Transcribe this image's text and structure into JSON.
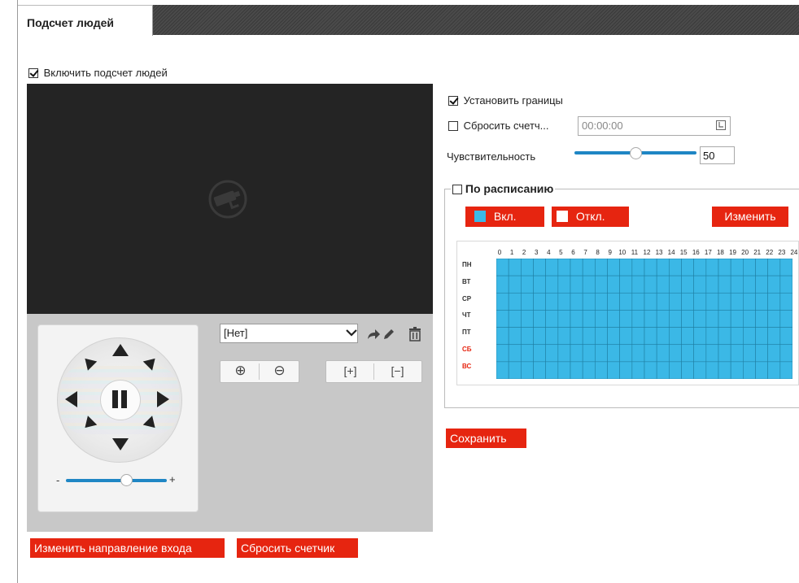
{
  "tab": {
    "title": "Подсчет людей"
  },
  "enable_counting": {
    "label": "Включить подсчет людей",
    "checked": true
  },
  "ptz": {
    "preset_value": "[Нет]",
    "icons": [
      "call-preset-icon",
      "edit-preset-icon",
      "delete-preset-icon"
    ],
    "zoom_in_glyph": "⊕",
    "zoom_out_glyph": "⊖",
    "focus_near_glyph": "[+]",
    "focus_far_glyph": "[−]",
    "speed_minus": "-",
    "speed_plus": "+"
  },
  "settings": {
    "set_borders": {
      "label": "Установить границы",
      "checked": true
    },
    "reset_counter_time": {
      "label": "Сбросить счетч...",
      "checked": false,
      "value": "00:00:00"
    },
    "sensitivity": {
      "label": "Чувствительность",
      "value": "50",
      "level": 0.5
    }
  },
  "schedule": {
    "legend": "По расписанию",
    "checked": false,
    "on_label": "Вкл.",
    "off_label": "Откл.",
    "edit_label": "Изменить",
    "on_color": "#3bb8e6",
    "hours": [
      "0",
      "1",
      "2",
      "3",
      "4",
      "5",
      "6",
      "7",
      "8",
      "9",
      "10",
      "11",
      "12",
      "13",
      "14",
      "15",
      "16",
      "17",
      "18",
      "19",
      "20",
      "21",
      "22",
      "23",
      "24"
    ],
    "days": [
      "ПН",
      "ВТ",
      "СР",
      "ЧТ",
      "ПТ",
      "СБ",
      "ВС"
    ]
  },
  "buttons": {
    "save": "Сохранить",
    "change_direction": "Изменить направление входа",
    "reset_counter": "Сбросить счетчик"
  },
  "colors": {
    "accent": "#e62510",
    "grid_on": "#3bb8e6",
    "video_bg": "#242424"
  }
}
